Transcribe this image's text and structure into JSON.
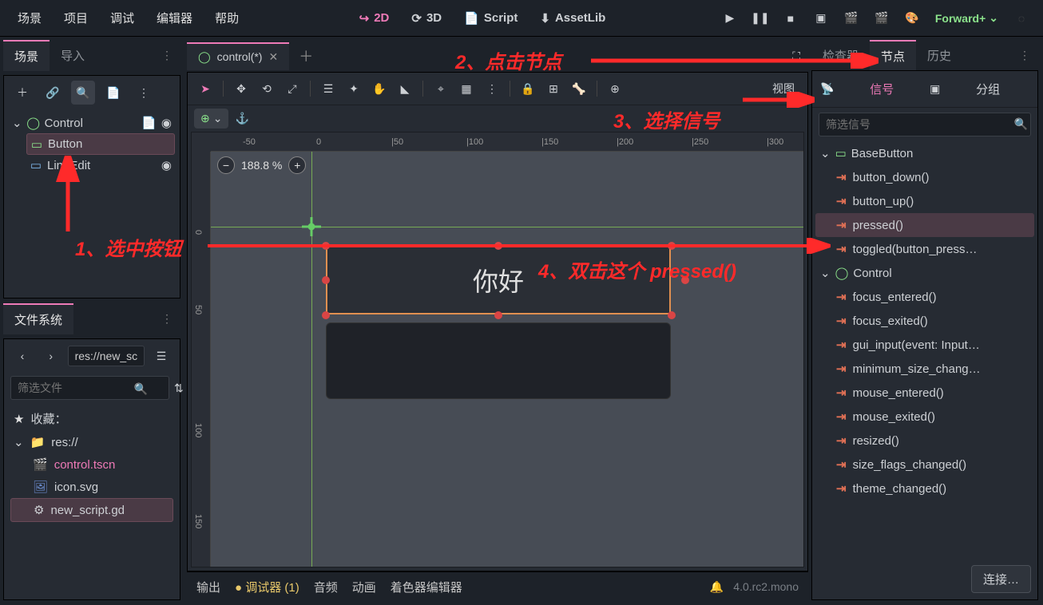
{
  "menu": {
    "scene": "场景",
    "project": "项目",
    "debug": "调试",
    "editor": "编辑器",
    "help": "帮助"
  },
  "workspace": {
    "d2": "2D",
    "d3": "3D",
    "script": "Script",
    "assetlib": "AssetLib"
  },
  "renderer": "Forward+",
  "left_tabs": {
    "scene": "场景",
    "import": "导入"
  },
  "scene_tree": {
    "root": "Control",
    "button": "Button",
    "lineedit": "LineEdit"
  },
  "fs": {
    "title": "文件系统",
    "path": "res://new_sc",
    "filter_ph": "筛选文件",
    "fav": "收藏：",
    "root": "res://",
    "files": [
      "control.tscn",
      "icon.svg",
      "new_script.gd"
    ]
  },
  "viewport": {
    "tab": "control(*)",
    "zoom": "188.8 %",
    "view_btn": "视图",
    "button_text": "你好"
  },
  "ruler_h": [
    {
      "v": "-50",
      "p": 40
    },
    {
      "v": "0",
      "p": 132
    },
    {
      "v": "|50",
      "p": 226
    },
    {
      "v": "|100",
      "p": 320
    },
    {
      "v": "|150",
      "p": 414
    },
    {
      "v": "|200",
      "p": 508
    },
    {
      "v": "|250",
      "p": 602
    },
    {
      "v": "|300",
      "p": 696
    }
  ],
  "ruler_v": [
    {
      "v": "0",
      "p": 98
    },
    {
      "v": "50",
      "p": 192
    },
    {
      "v": "100",
      "p": 340
    },
    {
      "v": "150",
      "p": 454
    }
  ],
  "bottom": {
    "output": "输出",
    "debugger": "调试器 (1)",
    "audio": "音频",
    "anim": "动画",
    "shader": "着色器编辑器",
    "version": "4.0.rc2.mono",
    "connect": "连接…"
  },
  "right_tabs": {
    "inspector": "检查器",
    "node": "节点",
    "history": "历史"
  },
  "node_sub": {
    "signals": "信号",
    "groups": "分组"
  },
  "sig_filter_ph": "筛选信号",
  "sig_groups": [
    {
      "name": "BaseButton",
      "icon": "base",
      "items": [
        "button_down()",
        "button_up()",
        "pressed()",
        "toggled(button_press…"
      ]
    },
    {
      "name": "Control",
      "icon": "control",
      "items": [
        "focus_entered()",
        "focus_exited()",
        "gui_input(event: Input…",
        "minimum_size_chang…",
        "mouse_entered()",
        "mouse_exited()",
        "resized()",
        "size_flags_changed()",
        "theme_changed()"
      ]
    }
  ],
  "annotations": {
    "a1": "1、选中按钮",
    "a2": "2、点击节点",
    "a3": "3、选择信号",
    "a4": "4、双击这个 pressed()"
  }
}
